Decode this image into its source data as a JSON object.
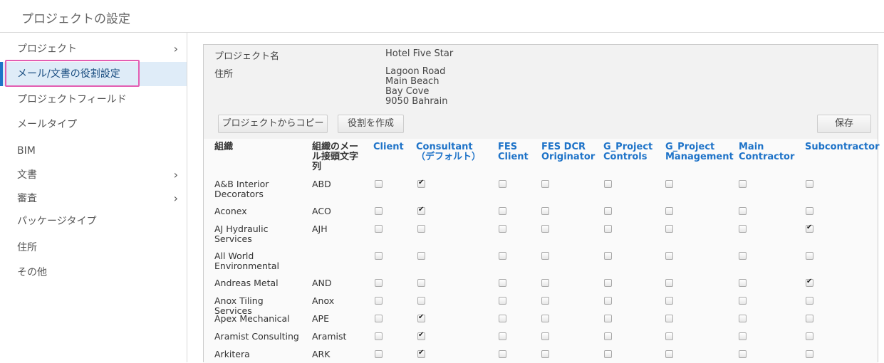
{
  "page_title": "プロジェクトの設定",
  "sidebar": {
    "items": [
      {
        "label": "プロジェクト",
        "chevron": true
      },
      {
        "label": "メール/文書の役割設定",
        "chevron": false,
        "active": true
      },
      {
        "label": "プロジェクトフィールド",
        "chevron": false
      },
      {
        "label": "メールタイプ",
        "chevron": false
      },
      {
        "label": "BIM",
        "chevron": false
      },
      {
        "label": "文書",
        "chevron": true
      },
      {
        "label": "審査",
        "chevron": true
      },
      {
        "label": "パッケージタイプ",
        "chevron": false
      },
      {
        "label": "住所",
        "chevron": false
      },
      {
        "label": "その他",
        "chevron": false
      }
    ]
  },
  "project_info": {
    "name_label": "プロジェクト名",
    "name_value": "Hotel Five Star",
    "address_label": "住所",
    "address_lines": [
      "Lagoon Road",
      "Main Beach",
      "Bay Cove",
      "9050 Bahrain"
    ]
  },
  "toolbar": {
    "copy_label": "プロジェクトからコピー",
    "create_role_label": "役割を作成",
    "save_label": "保存"
  },
  "table": {
    "headers": {
      "org": "組織",
      "prefix": "組織のメール接頭文字列",
      "roles": [
        "Client",
        "Consultant（デフォルト）",
        "FES Client",
        "FES DCR Originator",
        "G_Project Controls",
        "G_Project Management",
        "Main Contractor",
        "Subcontractor"
      ]
    },
    "rows": [
      {
        "org": "A&B Interior Decorators",
        "prefix": "ABD",
        "checks": [
          false,
          true,
          false,
          false,
          false,
          false,
          false,
          false
        ]
      },
      {
        "org": "Aconex",
        "prefix": "ACO",
        "checks": [
          false,
          true,
          false,
          false,
          false,
          false,
          false,
          false
        ]
      },
      {
        "org": "AJ Hydraulic Services",
        "prefix": "AJH",
        "checks": [
          false,
          false,
          false,
          false,
          false,
          false,
          false,
          true
        ]
      },
      {
        "org": "All World Environmental",
        "prefix": "",
        "checks": [
          false,
          false,
          false,
          false,
          false,
          false,
          false,
          false
        ]
      },
      {
        "org": "Andreas Metal",
        "prefix": "AND",
        "checks": [
          false,
          false,
          false,
          false,
          false,
          false,
          false,
          true
        ]
      },
      {
        "org": "Anox Tiling Services",
        "prefix": "Anox",
        "checks": [
          false,
          false,
          false,
          false,
          false,
          false,
          false,
          false
        ]
      },
      {
        "org": "Apex Mechanical",
        "prefix": "APE",
        "checks": [
          false,
          true,
          false,
          false,
          false,
          false,
          false,
          false
        ]
      },
      {
        "org": "Aramist Consulting",
        "prefix": "Aramist",
        "checks": [
          false,
          true,
          false,
          false,
          false,
          false,
          false,
          false
        ]
      },
      {
        "org": "Arkitera",
        "prefix": "ARK",
        "checks": [
          false,
          true,
          false,
          false,
          false,
          false,
          false,
          false
        ]
      }
    ]
  }
}
